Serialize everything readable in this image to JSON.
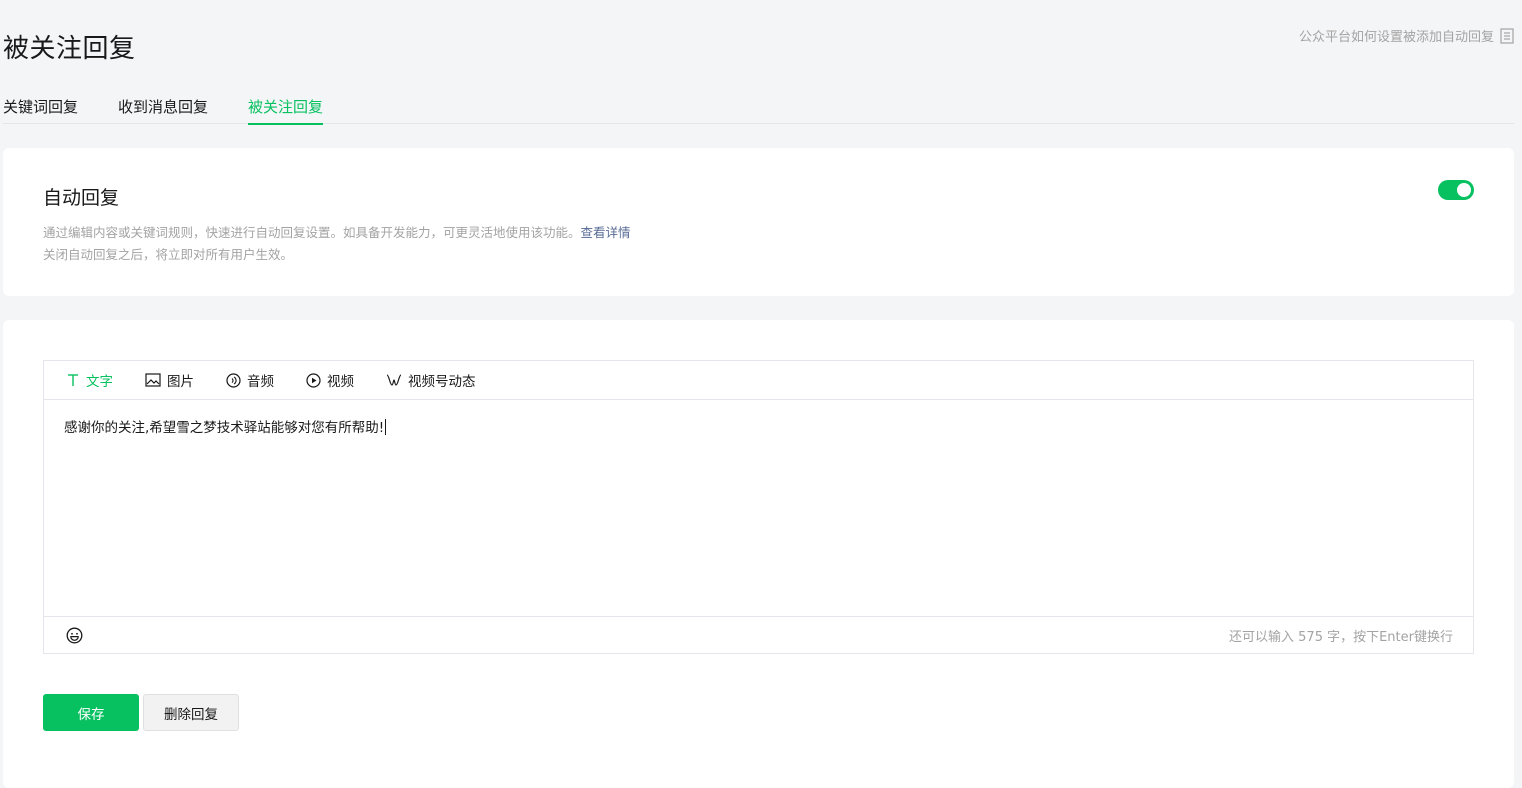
{
  "header": {
    "title": "被关注回复",
    "help_link": "公众平台如何设置被添加自动回复",
    "help_icon": "document-icon"
  },
  "tabs": [
    {
      "label": "关键词回复",
      "active": false
    },
    {
      "label": "收到消息回复",
      "active": false
    },
    {
      "label": "被关注回复",
      "active": true
    }
  ],
  "auto_reply": {
    "title": "自动回复",
    "desc_line1": "通过编辑内容或关键词规则，快速进行自动回复设置。如具备开发能力，可更灵活地使用该功能。",
    "detail_link": "查看详情",
    "desc_line2": "关闭自动回复之后，将立即对所有用户生效。",
    "enabled": true
  },
  "editor": {
    "tabs": [
      {
        "label": "文字",
        "icon": "text-icon",
        "active": true
      },
      {
        "label": "图片",
        "icon": "image-icon",
        "active": false
      },
      {
        "label": "音频",
        "icon": "audio-icon",
        "active": false
      },
      {
        "label": "视频",
        "icon": "video-icon",
        "active": false
      },
      {
        "label": "视频号动态",
        "icon": "channels-icon",
        "active": false
      }
    ],
    "content": "感谢你的关注,希望雪之梦技术驿站能够对您有所帮助!",
    "char_count_hint": "还可以输入 575 字，按下Enter键换行",
    "emoji_icon": "emoji-icon"
  },
  "actions": {
    "save_label": "保存",
    "delete_label": "删除回复"
  },
  "colors": {
    "accent": "#07c160",
    "link": "#576b95",
    "muted": "#a3a3a3"
  }
}
